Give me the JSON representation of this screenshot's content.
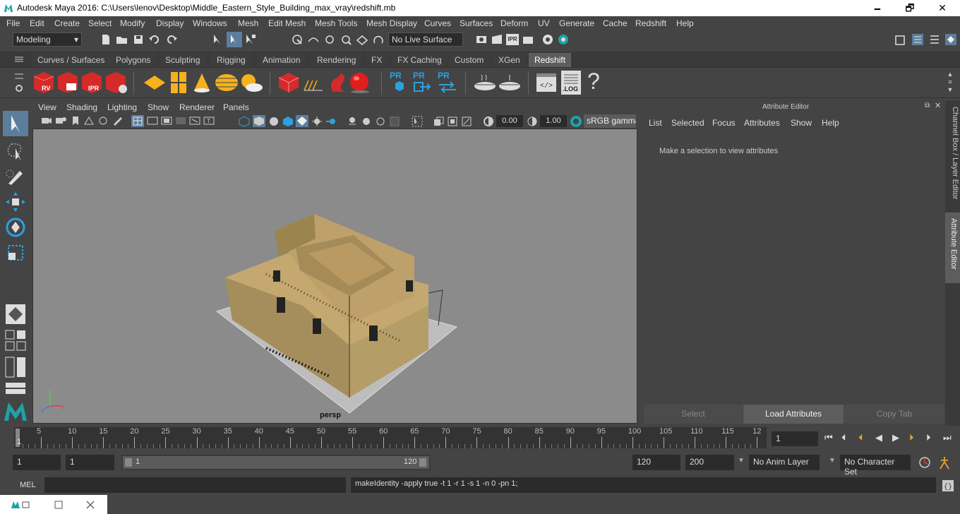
{
  "window": {
    "title": "Autodesk Maya 2016: C:\\Users\\lenov\\Desktop\\Middle_Eastern_Style_Building_max_vray\\redshift.mb",
    "minimize": "🗕",
    "maximize": "🗗",
    "close": "✕"
  },
  "menu": [
    "File",
    "Edit",
    "Create",
    "Select",
    "Modify",
    "Display",
    "Windows",
    "Mesh",
    "Edit Mesh",
    "Mesh Tools",
    "Mesh Display",
    "Curves",
    "Surfaces",
    "Deform",
    "UV",
    "Generate",
    "Cache",
    "Redshift",
    "Help"
  ],
  "status": {
    "mode": "Modeling",
    "live_surface": "No Live Surface"
  },
  "shelf_tabs": [
    "Curves / Surfaces",
    "Polygons",
    "Sculpting",
    "Rigging",
    "Animation",
    "Rendering",
    "FX",
    "FX Caching",
    "Custom",
    "XGen",
    "Redshift"
  ],
  "shelf_icons": {
    "rv": "RV",
    "ipr": "IPR",
    "pr": "PR",
    "log": ".LOG",
    "help": "?"
  },
  "viewport": {
    "menus": [
      "View",
      "Shading",
      "Lighting",
      "Show",
      "Renderer",
      "Panels"
    ],
    "exposure": "0.00",
    "gamma": "1.00",
    "colorspace": "sRGB gamma",
    "camera": "persp",
    "axis_y": "y",
    "axis_x": "x",
    "axis_z": "z"
  },
  "attribute_editor": {
    "title": "Attribute Editor",
    "menus": [
      "List",
      "Selected",
      "Focus",
      "Attributes",
      "Show",
      "Help"
    ],
    "message": "Make a selection to view attributes",
    "buttons": {
      "select": "Select",
      "load": "Load Attributes",
      "copy": "Copy Tab"
    }
  },
  "side_tabs": {
    "channel": "Channel Box / Layer Editor",
    "attr": "Attribute Editor"
  },
  "timeline": {
    "ticks": [
      "5",
      "10",
      "15",
      "20",
      "25",
      "30",
      "35",
      "40",
      "45",
      "50",
      "55",
      "60",
      "65",
      "70",
      "75",
      "80",
      "85",
      "90",
      "95",
      "100",
      "105",
      "110",
      "115",
      "12"
    ],
    "start": "1",
    "current": "1"
  },
  "range": {
    "start": "1",
    "start2": "1",
    "inner_start": "1",
    "inner_end": "120",
    "end": "120",
    "end2": "200",
    "anim_layer": "No Anim Layer",
    "char_set": "No Character Set"
  },
  "command": {
    "lang": "MEL",
    "input": "",
    "output": "makeIdentity -apply true -t 1 -r 1 -s 1 -n 0 -pn 1;"
  }
}
